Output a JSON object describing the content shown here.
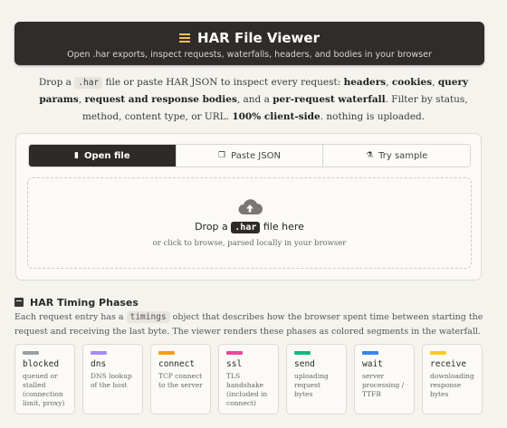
{
  "header": {
    "title": "HAR File Viewer",
    "subtitle": "Open .har exports, inspect requests, waterfalls, headers, and bodies in your browser"
  },
  "intro": {
    "p1": "Drop a ",
    "code": ".har",
    "p2": " file or paste HAR JSON to inspect every request: ",
    "b1": "headers",
    "s1": ", ",
    "b2": "cookies",
    "s2": ", ",
    "b3": "query params",
    "s3": ", ",
    "b4": "request and response bodies",
    "s4": ", and a ",
    "b5": "per-request waterfall",
    "s5": ". Filter by status, method, content type, or URL. ",
    "b6": "100% client-side",
    "s6": ". nothing is uploaded."
  },
  "tabs": [
    {
      "label": "Open file",
      "active": true
    },
    {
      "label": "Paste JSON",
      "active": false
    },
    {
      "label": "Try sample",
      "active": false
    }
  ],
  "dropzone": {
    "title_pre": "Drop a ",
    "badge": ".har",
    "title_post": " file here",
    "subtitle": "or click to browse, parsed locally in your browser"
  },
  "timing": {
    "title": "HAR Timing Phases",
    "desc_pre": "Each request entry has a ",
    "desc_code": "timings",
    "desc_post": " object that describes how the browser spent time between starting the request and receiving the last byte. The viewer renders these phases as colored segments in the waterfall.",
    "phases": [
      {
        "name": "blocked",
        "desc": "queued or stalled (connection limit, proxy)",
        "color": "#9aa0a6"
      },
      {
        "name": "dns",
        "desc": "DNS lookup of the host",
        "color": "#a78bfa"
      },
      {
        "name": "connect",
        "desc": "TCP connect to the server",
        "color": "#f59e0b"
      },
      {
        "name": "ssl",
        "desc": "TLS handshake (included in connect)",
        "color": "#ec4899"
      },
      {
        "name": "send",
        "desc": "uploading request bytes",
        "color": "#10b981"
      },
      {
        "name": "wait",
        "desc": "server processing / TTFB",
        "color": "#3b82f6"
      },
      {
        "name": "receive",
        "desc": "downloading response bytes",
        "color": "#facc15"
      }
    ]
  }
}
